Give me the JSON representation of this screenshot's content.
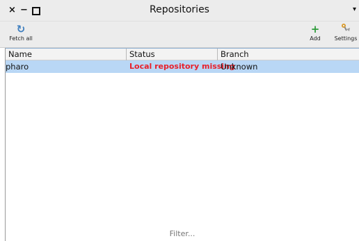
{
  "window": {
    "title": "Repositories",
    "close_glyph": "×",
    "minimize_glyph": "−",
    "menu_glyph": "▾"
  },
  "toolbar": {
    "fetch_label": "Fetch all",
    "fetch_icon": "refresh-icon",
    "add_label": "Add",
    "add_icon": "plus-icon",
    "settings_label": "Settings",
    "settings_icon": "wrench-icon"
  },
  "table": {
    "columns": [
      "Name",
      "Status",
      "Branch"
    ],
    "rows": [
      {
        "name": "pharo",
        "status": "Local repository missing",
        "branch": "Unknown"
      }
    ],
    "selected_row_color": "#b9d7f5",
    "status_error_color": "#e8202a"
  },
  "filter": {
    "placeholder": "Filter..."
  }
}
